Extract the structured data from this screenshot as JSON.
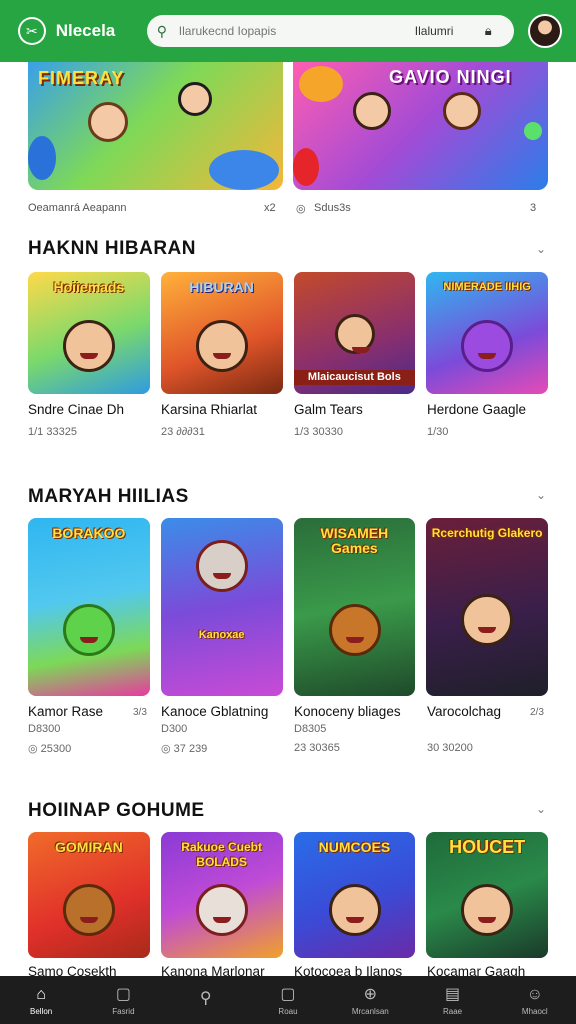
{
  "header": {
    "brand": "Nlecela",
    "search_placeholder": "Ilarukecnd Iopapis",
    "location": "Ilalumri",
    "colors": {
      "bar": "#27a543"
    }
  },
  "featured": {
    "banners": [
      {
        "title": "FIMERAY",
        "colors": [
          "#3aa0e8",
          "#7ed957",
          "#f5b63a"
        ]
      },
      {
        "title": "GAVIO NINGI",
        "colors": [
          "#ff5db1",
          "#a34bd6",
          "#2b7de9"
        ]
      }
    ],
    "left_caption": "Oeamanrá Aeapann",
    "middle_count": "x2",
    "right_label": "Sdus3s",
    "right_count": "3"
  },
  "sections": [
    {
      "title": "HAKNN HIBARAN",
      "items": [
        {
          "tile_text": "Hoiiemads",
          "caption": "Sndre Cinae Dh",
          "sub": "1/1 33325"
        },
        {
          "tile_text": "HIBURAN",
          "caption": "Karsina Rhiarlat",
          "sub": "23 ∂∂∂31"
        },
        {
          "tile_text": "Mlaicaucisut Bols",
          "caption": "Galm Tears",
          "sub": "1/3 30330"
        },
        {
          "tile_text": "NIMERADE IIHIG",
          "caption": "Herdone Gaagle",
          "sub": "1/30"
        }
      ]
    },
    {
      "title": "MARYAH HIILIAS",
      "items": [
        {
          "tile_text": "BORAKOO",
          "caption": "Kamor Rase",
          "badge": "3/3",
          "sub": "D8300",
          "sub2": "25300"
        },
        {
          "tile_text": "Kanoxae",
          "caption": "Kanoce Gblatning",
          "sub": "D300",
          "sub2": "37 239"
        },
        {
          "tile_text": "WISAMEH Games",
          "caption": "Konoceny bliages",
          "sub": "D8305",
          "sub2": "23 30365"
        },
        {
          "tile_text": "Rcerchutig Glakero",
          "caption": "Varocolchag",
          "badge": "2/3",
          "sub": "",
          "sub2": "30 30200"
        }
      ]
    },
    {
      "title": "HOIINAP GOHUME",
      "items": [
        {
          "tile_text": "GOMIRAN",
          "caption": "Samo Cosekth"
        },
        {
          "tile_text": "Rakuoe Cuebt BOLADS",
          "caption": "Kanona Marlonar"
        },
        {
          "tile_text": "NUMCOES",
          "caption": "Kotocoea b Ilanos"
        },
        {
          "tile_text": "HOUCET",
          "caption": "Kocamar Gaagh"
        }
      ]
    }
  ],
  "nav": [
    {
      "label": "Bellon",
      "icon": "home-icon"
    },
    {
      "label": "Fasrid",
      "icon": "square-icon"
    },
    {
      "label": "",
      "icon": "search-icon"
    },
    {
      "label": "Roau",
      "icon": "square-icon"
    },
    {
      "label": "Mrcanlsan",
      "icon": "plus-circle-icon"
    },
    {
      "label": "Raae",
      "icon": "list-icon"
    },
    {
      "label": "Mhaocl",
      "icon": "person-icon"
    }
  ]
}
